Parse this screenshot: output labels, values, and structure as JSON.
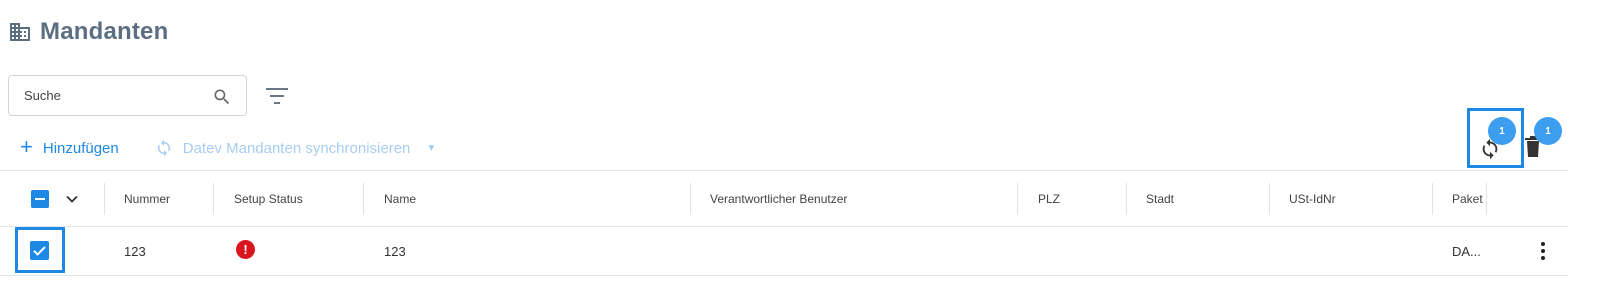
{
  "page": {
    "title": "Mandanten",
    "title_icon": "building-icon"
  },
  "search": {
    "placeholder": "Suche",
    "value": ""
  },
  "toolbar": {
    "add_label": "Hinzufügen",
    "sync_label": "Datev Mandanten synchronisieren",
    "sync_enabled": false
  },
  "actions": {
    "sync_badge": "1",
    "delete_badge": "1"
  },
  "table": {
    "columns": [
      "Nummer",
      "Setup Status",
      "Name",
      "Verantwortlicher Benutzer",
      "PLZ",
      "Stadt",
      "USt-IdNr",
      "Paket"
    ],
    "header_checkbox_state": "partial",
    "rows": [
      {
        "selected": true,
        "nummer": "123",
        "setup_status": "error",
        "setup_status_icon": "!",
        "name": "123",
        "verantwortlicher_benutzer": "",
        "plz": "",
        "stadt": "",
        "ust_idnr": "",
        "paket": "DA..."
      }
    ]
  },
  "colors": {
    "accent": "#1e88e5",
    "badge": "#3d9ef0",
    "error": "#d9161f",
    "title": "#5c6f82",
    "disabled": "#a8cdf2"
  }
}
